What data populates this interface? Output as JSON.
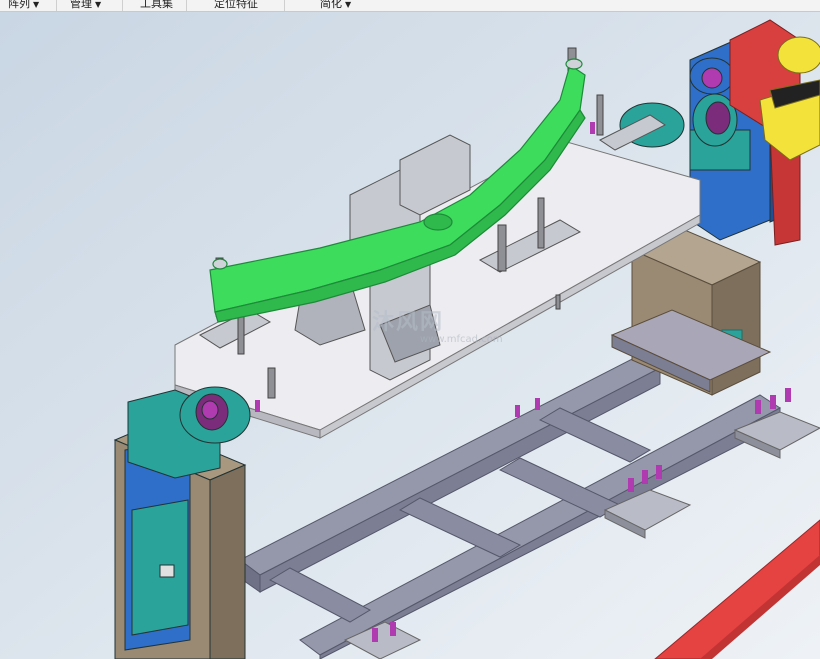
{
  "ribbon": {
    "groups": [
      {
        "label": "阵列",
        "has_dropdown": true
      },
      {
        "label": "管理",
        "has_dropdown": true
      },
      {
        "label": "工具集",
        "has_dropdown": false
      },
      {
        "label": "定位特征",
        "has_dropdown": false
      },
      {
        "label": "简化",
        "has_dropdown": true
      }
    ],
    "dropdown_glyph": "▼"
  },
  "watermark": {
    "text": "沐风网",
    "sub": "www.mfcad.com"
  },
  "colors": {
    "background": "#dfe7ef",
    "fixture_plate": "#e9e9ec",
    "selected_part": "#3ddc5c",
    "base_frame": "#8d8fa3",
    "teal_housing": "#2aa39b",
    "blue_body": "#2f6fc9",
    "post": "#9a8a74",
    "motor_red": "#d84040",
    "robot_yellow": "#f2e23a",
    "fastener_magenta": "#b03ab0",
    "floor_rail": "#e54242"
  }
}
